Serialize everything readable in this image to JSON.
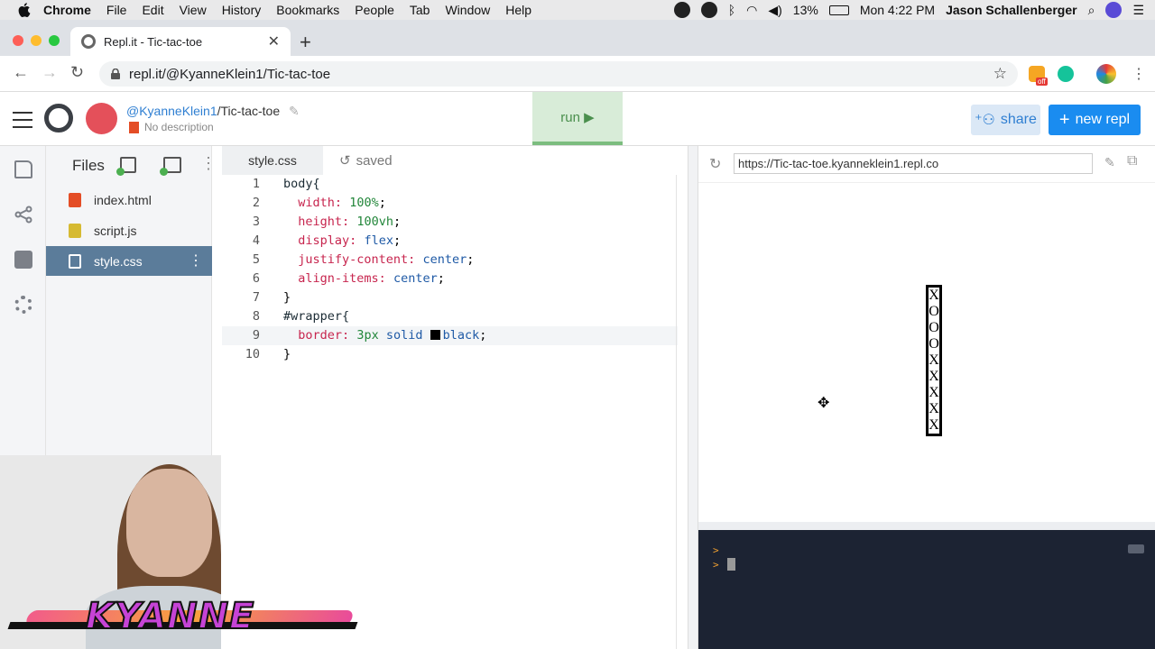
{
  "menubar": {
    "app": "Chrome",
    "items": [
      "File",
      "Edit",
      "View",
      "History",
      "Bookmarks",
      "People",
      "Tab",
      "Window",
      "Help"
    ],
    "battery": "13%",
    "clock": "Mon 4:22 PM",
    "user": "Jason Schallenberger"
  },
  "browser": {
    "tab_title": "Repl.it - Tic-tac-toe",
    "url": "repl.it/@KyanneKlein1/Tic-tac-toe",
    "ext_badge": "off"
  },
  "repl": {
    "owner": "@KyanneKlein1",
    "separator": "/",
    "name": "Tic-tac-toe",
    "description": "No description",
    "run_label": "run ▶",
    "share_label": "share",
    "new_repl_label": "new repl"
  },
  "files": {
    "title": "Files",
    "items": [
      {
        "name": "index.html",
        "icon": "html5-icon",
        "color": "#e44d26"
      },
      {
        "name": "script.js",
        "icon": "js-icon",
        "color": "#d6ba32"
      },
      {
        "name": "style.css",
        "icon": "css3-icon",
        "color": "#ffffff"
      }
    ],
    "active": "style.css"
  },
  "editor": {
    "tab": "style.css",
    "status": "saved",
    "lines": [
      {
        "n": "1",
        "text": "body{"
      },
      {
        "n": "2",
        "text": "  width: 100%;"
      },
      {
        "n": "3",
        "text": "  height: 100vh;"
      },
      {
        "n": "4",
        "text": "  display: flex;"
      },
      {
        "n": "5",
        "text": "  justify-content: center;"
      },
      {
        "n": "6",
        "text": "  align-items: center;"
      },
      {
        "n": "7",
        "text": "}"
      },
      {
        "n": "8",
        "text": "#wrapper{"
      },
      {
        "n": "9",
        "text": "  border: 3px solid black;"
      },
      {
        "n": "10",
        "text": "}"
      }
    ],
    "current_line": "9"
  },
  "preview": {
    "url": "https://Tic-tac-toe.kyanneklein1.repl.co",
    "cells": [
      "X",
      "O",
      "O",
      "O",
      "X",
      "X",
      "X",
      "X",
      "X"
    ]
  },
  "console": {
    "prompt": ">"
  },
  "overlay": {
    "name": "KYANNE"
  },
  "colors": {
    "run_bg": "#d8ecd8",
    "run_accent": "#7cbd7f",
    "new_repl": "#1a8cf0",
    "share_bg": "#dbe8f6",
    "active_file": "#5b7c9a",
    "console_bg": "#1c2333"
  }
}
